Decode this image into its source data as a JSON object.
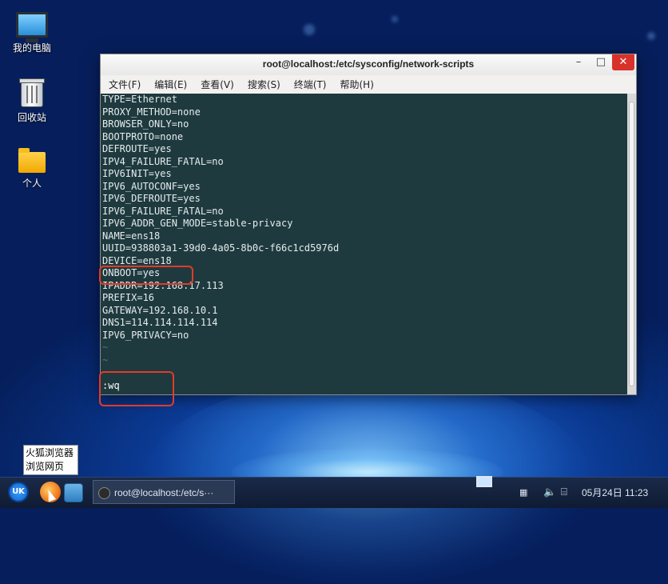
{
  "desktop": {
    "icons": [
      {
        "label": "我的电脑"
      },
      {
        "label": "回收站"
      },
      {
        "label": "个人"
      }
    ]
  },
  "window": {
    "title": "root@localhost:/etc/sysconfig/network-scripts",
    "menu": [
      "文件(F)",
      "编辑(E)",
      "查看(V)",
      "搜索(S)",
      "终端(T)",
      "帮助(H)"
    ]
  },
  "terminal": {
    "lines": [
      "TYPE=Ethernet",
      "PROXY_METHOD=none",
      "BROWSER_ONLY=no",
      "BOOTPROTO=none",
      "DEFROUTE=yes",
      "IPV4_FAILURE_FATAL=no",
      "IPV6INIT=yes",
      "IPV6_AUTOCONF=yes",
      "IPV6_DEFROUTE=yes",
      "IPV6_FAILURE_FATAL=no",
      "IPV6_ADDR_GEN_MODE=stable-privacy",
      "NAME=ens18",
      "UUID=938803a1-39d0-4a05-8b0c-f66c1cd5976d",
      "DEVICE=ens18",
      "ONBOOT=yes",
      "IPADDR=192.168.17.113",
      "PREFIX=16",
      "GATEWAY=192.168.10.1",
      "DNS1=114.114.114.114",
      "IPV6_PRIVACY=no",
      "~",
      "~"
    ],
    "command": ":wq"
  },
  "tooltip": {
    "line1": "火狐浏览器",
    "line2": "浏览网页"
  },
  "taskbar": {
    "start_label": "UK",
    "task_label": "root@localhost:/etc/s···",
    "clock": "05月24日 11:23"
  }
}
